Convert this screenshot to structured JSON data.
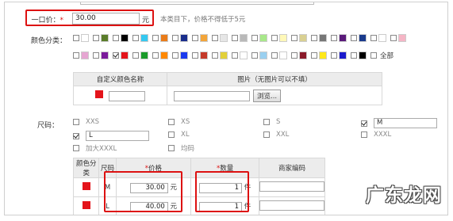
{
  "price": {
    "label": "一口价：",
    "required_mark": "*",
    "value": "30.00",
    "unit": "元",
    "hint": "本类目下，价格不得低于5元"
  },
  "color": {
    "label": "颜色分类：",
    "row1": [
      {
        "color": "#ffffff",
        "checked": false
      },
      {
        "color": "#5a7d2a",
        "checked": false
      },
      {
        "color": "#000000",
        "checked": false
      },
      {
        "color": "#35c8f0",
        "checked": false
      },
      {
        "color": "#e97c1a",
        "checked": false
      },
      {
        "color": "#1a2e8c",
        "checked": false
      },
      {
        "color": "#f2a53a",
        "checked": false
      },
      {
        "color": "#e6e6e6",
        "checked": false
      },
      {
        "color": "#b9b9b9",
        "checked": false
      },
      {
        "color": "#a8e88a",
        "checked": false
      },
      {
        "color": "#fff8b8",
        "checked": false
      },
      {
        "color": "#d9d092",
        "checked": false
      },
      {
        "color": "#777777",
        "checked": false
      },
      {
        "color": "#5a1a7a",
        "checked": false
      },
      {
        "color": "#1a3a8c",
        "checked": false
      },
      {
        "color": "#ffffff",
        "checked": false
      },
      {
        "color": "#f5b5c5",
        "checked": false
      }
    ],
    "row2": [
      {
        "color": "#e6a6d2",
        "checked": false
      },
      {
        "color": "#7a1a9a",
        "checked": false
      },
      {
        "color": "#e4141b",
        "checked": true
      },
      {
        "color": "#1a9a2a",
        "checked": false
      },
      {
        "color": "#ff8800",
        "checked": false
      },
      {
        "color": "#1a3aee",
        "checked": false
      },
      {
        "color": "#c43a2a",
        "checked": false
      },
      {
        "color": "#e2d03a",
        "checked": false
      },
      {
        "color": "#ffffff",
        "checked": false
      },
      {
        "color": "#9ad0f0",
        "checked": false
      },
      {
        "color": "#ffffff",
        "checked": false
      },
      {
        "color": "#8a1a2a",
        "checked": false
      },
      {
        "color": "#ffe81a",
        "checked": false
      },
      {
        "color": "#1a1acc",
        "checked": false
      },
      {
        "color": "#000000",
        "checked": false
      }
    ],
    "select_all": "全部",
    "custom": {
      "header_name": "自定义颜色名称",
      "header_image": "图片（无图片可以不填）",
      "swatch": "#e4141b",
      "browse": "浏览..."
    }
  },
  "size": {
    "label": "尺码：",
    "options": [
      {
        "name": "XXS",
        "checked": false,
        "input": null
      },
      {
        "name": "XS",
        "checked": false,
        "input": null
      },
      {
        "name": "S",
        "checked": false,
        "input": null
      },
      {
        "name": "M",
        "checked": true,
        "input": "M"
      },
      {
        "name": "L",
        "checked": true,
        "input": "L"
      },
      {
        "name": "XL",
        "checked": false,
        "input": null
      },
      {
        "name": "XXL",
        "checked": false,
        "input": null
      },
      {
        "name": "XXXL",
        "checked": false,
        "input": null
      },
      {
        "name": "加大XXXL",
        "checked": false,
        "input": null
      },
      {
        "name": "均码",
        "checked": false,
        "input": null
      }
    ]
  },
  "sku": {
    "headers": {
      "color": "颜色分类",
      "size": "尺码",
      "price_mark": "*",
      "price": "价格",
      "qty_mark": "*",
      "qty": "数量",
      "code": "商家编码"
    },
    "rows": [
      {
        "swatch": "#e4141b",
        "size": "M",
        "price": "30.00",
        "price_unit": "元",
        "qty": "1",
        "qty_unit": "件"
      },
      {
        "swatch": "#e4141b",
        "size": "L",
        "price": "40.00",
        "price_unit": "元",
        "qty": "1",
        "qty_unit": "件"
      }
    ]
  },
  "watermark": "广东龙网"
}
